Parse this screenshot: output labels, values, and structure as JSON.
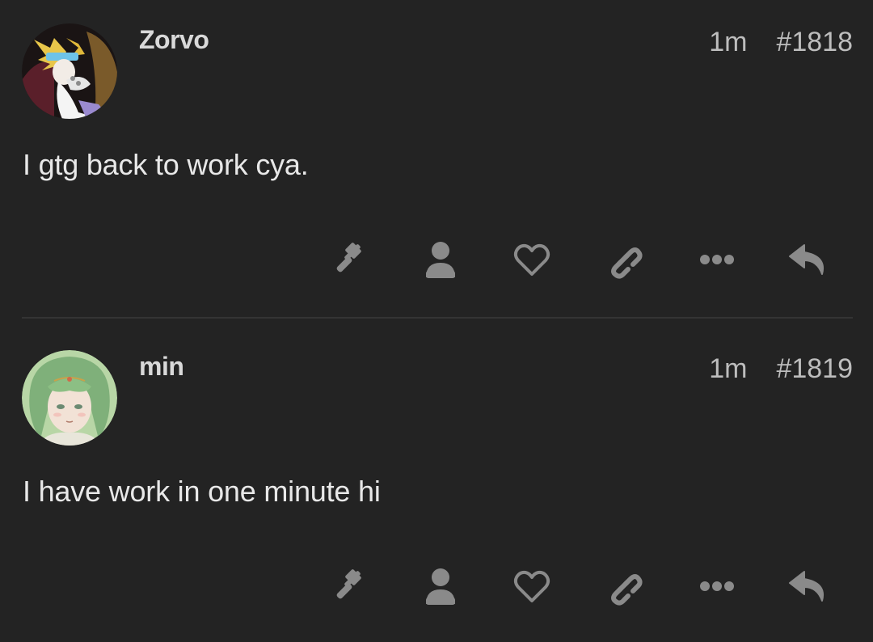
{
  "posts": [
    {
      "username": "Zorvo",
      "time": "1m",
      "number": "#1818",
      "text": "I gtg back to work cya.",
      "avatar_icon": "zorvo-avatar",
      "actions": [
        "gavel-icon",
        "user-icon",
        "heart-icon",
        "link-icon",
        "ellipsis-icon",
        "reply-icon"
      ]
    },
    {
      "username": "min",
      "time": "1m",
      "number": "#1819",
      "text": "I have work in one minute hi",
      "avatar_icon": "min-avatar",
      "actions": [
        "gavel-icon",
        "user-icon",
        "heart-icon",
        "link-icon",
        "ellipsis-icon",
        "reply-icon"
      ]
    }
  ],
  "colors": {
    "background": "#232323",
    "icon": "#8a8a8a",
    "divider": "#343434"
  }
}
